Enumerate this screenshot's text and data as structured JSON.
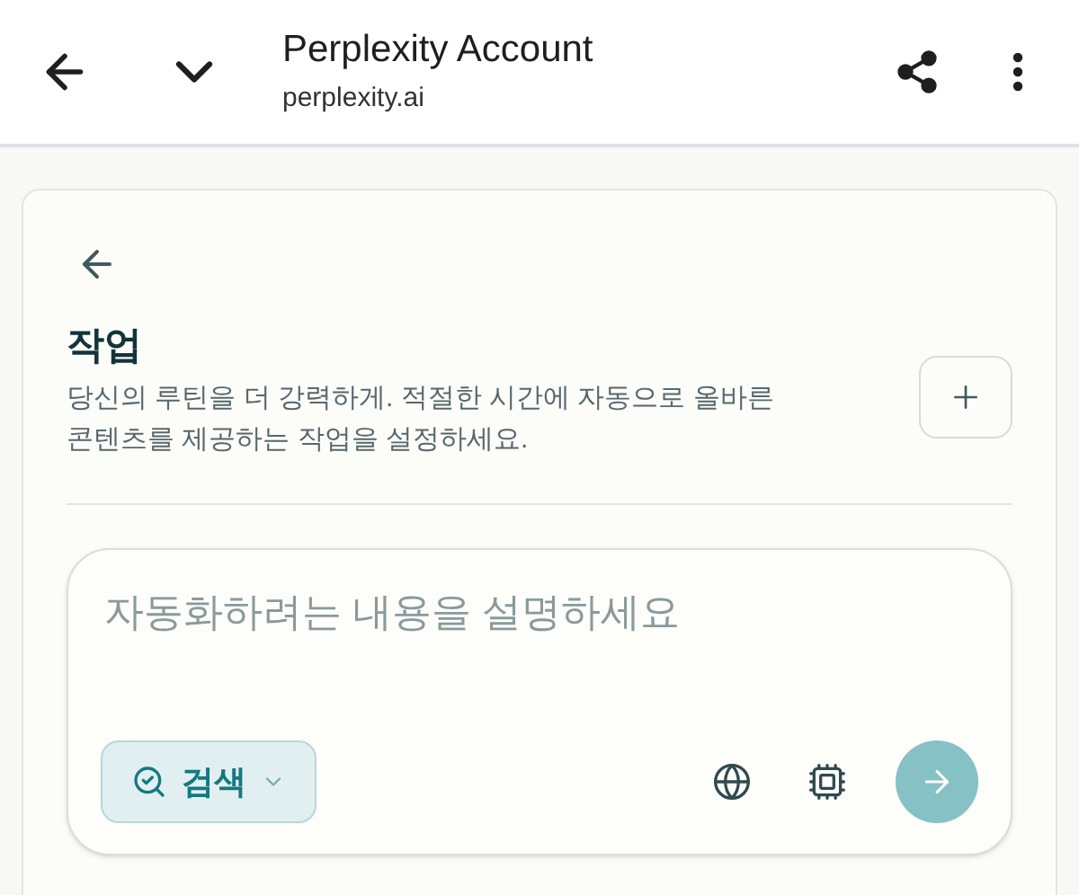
{
  "browser_bar": {
    "title": "Perplexity Account",
    "url": "perplexity.ai"
  },
  "tasks": {
    "title": "작업",
    "description": "당신의 루틴을 더 강력하게. 적절한 시간에 자동으로 올바른 콘텐츠를 제공하는 작업을 설정하세요."
  },
  "composer": {
    "placeholder": "자동화하려는 내용을 설명하세요",
    "mode": {
      "label": "검색"
    },
    "send": {
      "disabled": true
    }
  }
}
